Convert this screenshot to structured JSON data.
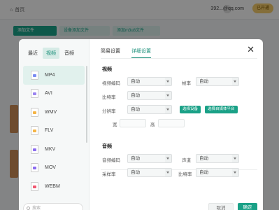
{
  "header": {
    "home_label": "首页",
    "email": "392...@qq.com",
    "vip_label": "已开通"
  },
  "toolbar": {
    "add_file": "添加文件",
    "add_device": "设备添加文件",
    "add_m3u8": "添加m3u8文件"
  },
  "dialog": {
    "left_tabs": [
      "最近",
      "视频",
      "音频"
    ],
    "active_left_tab": "视频",
    "formats": [
      "MP4",
      "AVI",
      "WMV",
      "FLV",
      "MKV",
      "MOV",
      "WEBM"
    ],
    "format_colors": [
      "#7b8cf2",
      "#9a83f0",
      "#f4b445",
      "#f4b445",
      "#8b6cf0",
      "#8b6cf0",
      "#f0566f"
    ],
    "active_format": "MP4",
    "search_placeholder": "搜索",
    "right_tabs": [
      "简易设置",
      "详细设置"
    ],
    "active_right_tab": "详细设置",
    "video": {
      "title": "视频",
      "codec_label": "视频编码",
      "codec_value": "自动",
      "framerate_label": "帧率",
      "framerate_value": "自动",
      "bitrate_label": "比特率",
      "bitrate_value": "自动",
      "resolution_label": "分辨率",
      "resolution_value": "自动",
      "select_device": "选择设备",
      "select_platform": "选择自媒体平台",
      "width_label": "宽",
      "height_label": "高"
    },
    "audio": {
      "title": "音频",
      "codec_label": "音频编码",
      "codec_value": "自动",
      "channel_label": "声道",
      "channel_value": "自动",
      "samplerate_label": "采样率",
      "samplerate_value": "自动",
      "bitrate_label": "比特率",
      "bitrate_value": "自动"
    },
    "cancel_label": "取消",
    "confirm_label": "确定"
  }
}
